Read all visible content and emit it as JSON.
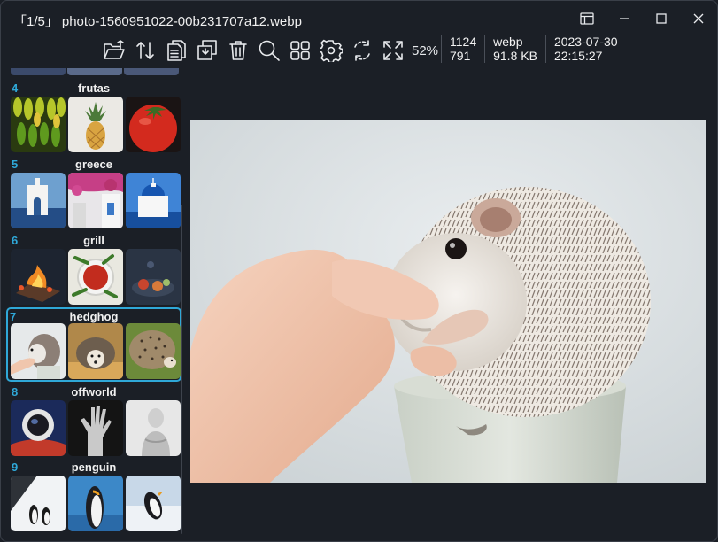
{
  "titlebar": {
    "counter": "「1/5」",
    "filename": "photo-1560951022-00b231707a12.webp"
  },
  "toolbar": {
    "icons": [
      "open-folder-icon",
      "sort-icon",
      "copy-icon",
      "copy-to-icon",
      "delete-icon",
      "search-icon",
      "gallery-icon",
      "settings-icon",
      "rotate-icon",
      "fullscreen-icon"
    ],
    "zoom": "52%"
  },
  "info": {
    "width": "1124",
    "height": "791",
    "format": "webp",
    "size": "91.8 KB",
    "date": "2023-07-30",
    "time": "22:15:27"
  },
  "sidebar": {
    "folders": [
      {
        "num": "4",
        "name": "frutas"
      },
      {
        "num": "5",
        "name": "greece"
      },
      {
        "num": "6",
        "name": "grill"
      },
      {
        "num": "7",
        "name": "hedghog"
      },
      {
        "num": "8",
        "name": "offworld"
      },
      {
        "num": "9",
        "name": "penguin"
      }
    ],
    "selected_index": 3
  },
  "colors": {
    "background": "#1b1f26",
    "accent": "#2fa8d8",
    "text": "#e8eaed"
  }
}
